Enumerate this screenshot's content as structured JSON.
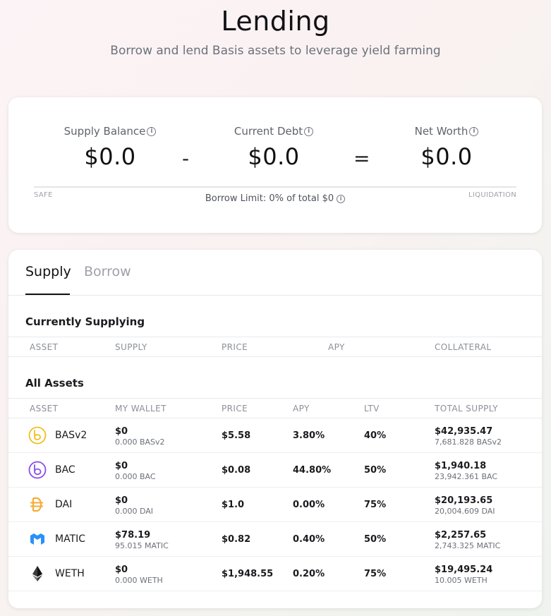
{
  "header": {
    "title": "Lending",
    "subtitle": "Borrow and lend Basis assets to leverage yield farming"
  },
  "summary": {
    "supply_balance_label": "Supply Balance",
    "supply_balance_value": "$0.0",
    "minus": "-",
    "current_debt_label": "Current Debt",
    "current_debt_value": "$0.0",
    "equals": "=",
    "net_worth_label": "Net Worth",
    "net_worth_value": "$0.0",
    "safe_label": "SAFE",
    "liquidation_label": "LIQUIDATION",
    "borrow_limit": "Borrow Limit: 0% of total $0"
  },
  "tabs": [
    {
      "label": "Supply",
      "active": true
    },
    {
      "label": "Borrow",
      "active": false
    }
  ],
  "currently_supplying": {
    "title": "Currently Supplying",
    "columns": [
      "ASSET",
      "SUPPLY",
      "PRICE",
      "APY",
      "COLLATERAL"
    ]
  },
  "all_assets": {
    "title": "All Assets",
    "columns": [
      "ASSET",
      "MY WALLET",
      "PRICE",
      "APY",
      "LTV",
      "TOTAL SUPPLY"
    ],
    "rows": [
      {
        "icon": "basv2-icon",
        "name": "BASv2",
        "wallet_usd": "$0",
        "wallet_amount": "0.000 BASv2",
        "price": "$5.58",
        "apy": "3.80%",
        "ltv": "40%",
        "total_usd": "$42,935.47",
        "total_amount": "7,681.828 BASv2"
      },
      {
        "icon": "bac-icon",
        "name": "BAC",
        "wallet_usd": "$0",
        "wallet_amount": "0.000 BAC",
        "price": "$0.08",
        "apy": "44.80%",
        "ltv": "50%",
        "total_usd": "$1,940.18",
        "total_amount": "23,942.361 BAC"
      },
      {
        "icon": "dai-icon",
        "name": "DAI",
        "wallet_usd": "$0",
        "wallet_amount": "0.000 DAI",
        "price": "$1.0",
        "apy": "0.00%",
        "ltv": "75%",
        "total_usd": "$20,193.65",
        "total_amount": "20,004.609 DAI"
      },
      {
        "icon": "matic-icon",
        "name": "MATIC",
        "wallet_usd": "$78.19",
        "wallet_amount": "95.015 MATIC",
        "price": "$0.82",
        "apy": "0.40%",
        "ltv": "50%",
        "total_usd": "$2,257.65",
        "total_amount": "2,743.325 MATIC"
      },
      {
        "icon": "weth-icon",
        "name": "WETH",
        "wallet_usd": "$0",
        "wallet_amount": "0.000 WETH",
        "price": "$1,948.55",
        "apy": "0.20%",
        "ltv": "75%",
        "total_usd": "$19,495.24",
        "total_amount": "10.005 WETH"
      }
    ]
  },
  "colors": {
    "basv2": "#f2b705",
    "bac": "#8b4ce8",
    "dai": "#f5ac37",
    "matic": "#2891f9",
    "weth": "#3c3c3d"
  }
}
